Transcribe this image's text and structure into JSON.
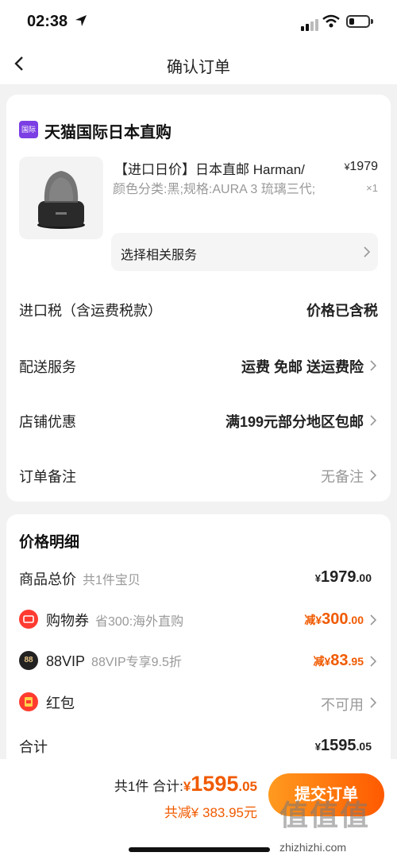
{
  "status_bar": {
    "time": "02:38"
  },
  "nav": {
    "title": "确认订单"
  },
  "shop": {
    "name": "天猫国际日本直购",
    "badge": "国际"
  },
  "product": {
    "title": "【进口日价】日本直邮 Harman/",
    "spec": "颜色分类:黑;规格:AURA 3 琉璃三代;",
    "price_currency": "¥",
    "price": "1979",
    "qty": "×1",
    "service_label": "选择相关服务"
  },
  "order_rows": [
    {
      "label": "进口税（含运费税款）",
      "value": "价格已含税"
    },
    {
      "label": "配送服务",
      "value": "运费 免邮 送运费险"
    },
    {
      "label": "店铺优惠",
      "value": "满199元部分地区包邮"
    },
    {
      "label": "订单备注",
      "value": "无备注"
    }
  ],
  "price_detail": {
    "title": "价格明细",
    "goods_label": "商品总价",
    "goods_sub": "共1件宝贝",
    "goods_cur": "¥",
    "goods_int": "1979",
    "goods_dec": ".00",
    "coupon_label": "购物券",
    "coupon_sub": "省300:海外直购",
    "coupon_prefix": "减¥",
    "coupon_int": "300",
    "coupon_dec": ".00",
    "vip_badge": "88",
    "vip_label": "88VIP",
    "vip_sub": "88VIP专享9.5折",
    "vip_prefix": "减¥",
    "vip_int": "83",
    "vip_dec": ".95",
    "redpacket_label": "红包",
    "redpacket_value": "不可用",
    "total_label": "合计",
    "total_cur": "¥",
    "total_int": "1595",
    "total_dec": ".05"
  },
  "bottom": {
    "count_text": "共1件",
    "total_label": "合计:",
    "total_cur": "¥",
    "total_int": "1595",
    "total_dec": ".05",
    "saved_text": "共减¥ 383.95元",
    "submit_label": "提交订单"
  },
  "watermark": {
    "text": "值值值",
    "url": "zhizhizhi.com"
  },
  "colors": {
    "accent": "#f05a00",
    "tmall_purple": "#7b3fe4",
    "coupon_red": "#ff3b30"
  }
}
